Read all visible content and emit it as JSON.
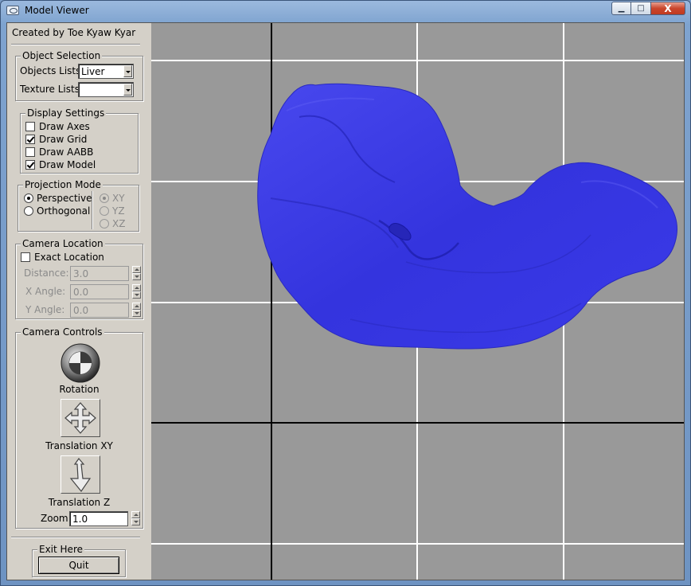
{
  "window": {
    "title": "Model Viewer",
    "buttons": {
      "minimize": "▁",
      "maximize": "□",
      "close": "X"
    }
  },
  "panel": {
    "credit": "Created by Toe Kyaw Kyar",
    "object_selection": {
      "title": "Object Selection",
      "objects_label": "Objects Lists",
      "objects_value": "Liver",
      "texture_label": "Texture Lists",
      "texture_value": ""
    },
    "display_settings": {
      "title": "Display Settings",
      "items": [
        {
          "label": "Draw Axes",
          "checked": false
        },
        {
          "label": "Draw Grid",
          "checked": true
        },
        {
          "label": "Draw AABB",
          "checked": false
        },
        {
          "label": "Draw Model",
          "checked": true
        }
      ]
    },
    "projection_mode": {
      "title": "Projection Mode",
      "modes": [
        {
          "label": "Perspective",
          "selected": true
        },
        {
          "label": "Orthogonal",
          "selected": false
        }
      ],
      "planes": [
        {
          "label": "XY",
          "selected": true,
          "disabled": true
        },
        {
          "label": "YZ",
          "selected": false,
          "disabled": true
        },
        {
          "label": "XZ",
          "selected": false,
          "disabled": true
        }
      ]
    },
    "camera_location": {
      "title": "Camera Location",
      "exact_label": "Exact Location",
      "exact_checked": false,
      "distance_label": "Distance:",
      "distance_value": "3.0",
      "x_angle_label": "X Angle:",
      "x_angle_value": "0.0",
      "y_angle_label": "Y Angle:",
      "y_angle_value": "0.0"
    },
    "camera_controls": {
      "title": "Camera Controls",
      "rotation_label": "Rotation",
      "translation_xy_label": "Translation XY",
      "translation_z_label": "Translation Z",
      "zoom_label": "Zoom",
      "zoom_value": "1.0"
    },
    "exit": {
      "title": "Exit Here",
      "quit_label": "Quit"
    }
  },
  "viewport": {
    "background_color": "#999999",
    "grid_color": "#ffffff",
    "axis_color": "#000000",
    "model_name": "Liver",
    "model_color": "#3a3ae6"
  }
}
